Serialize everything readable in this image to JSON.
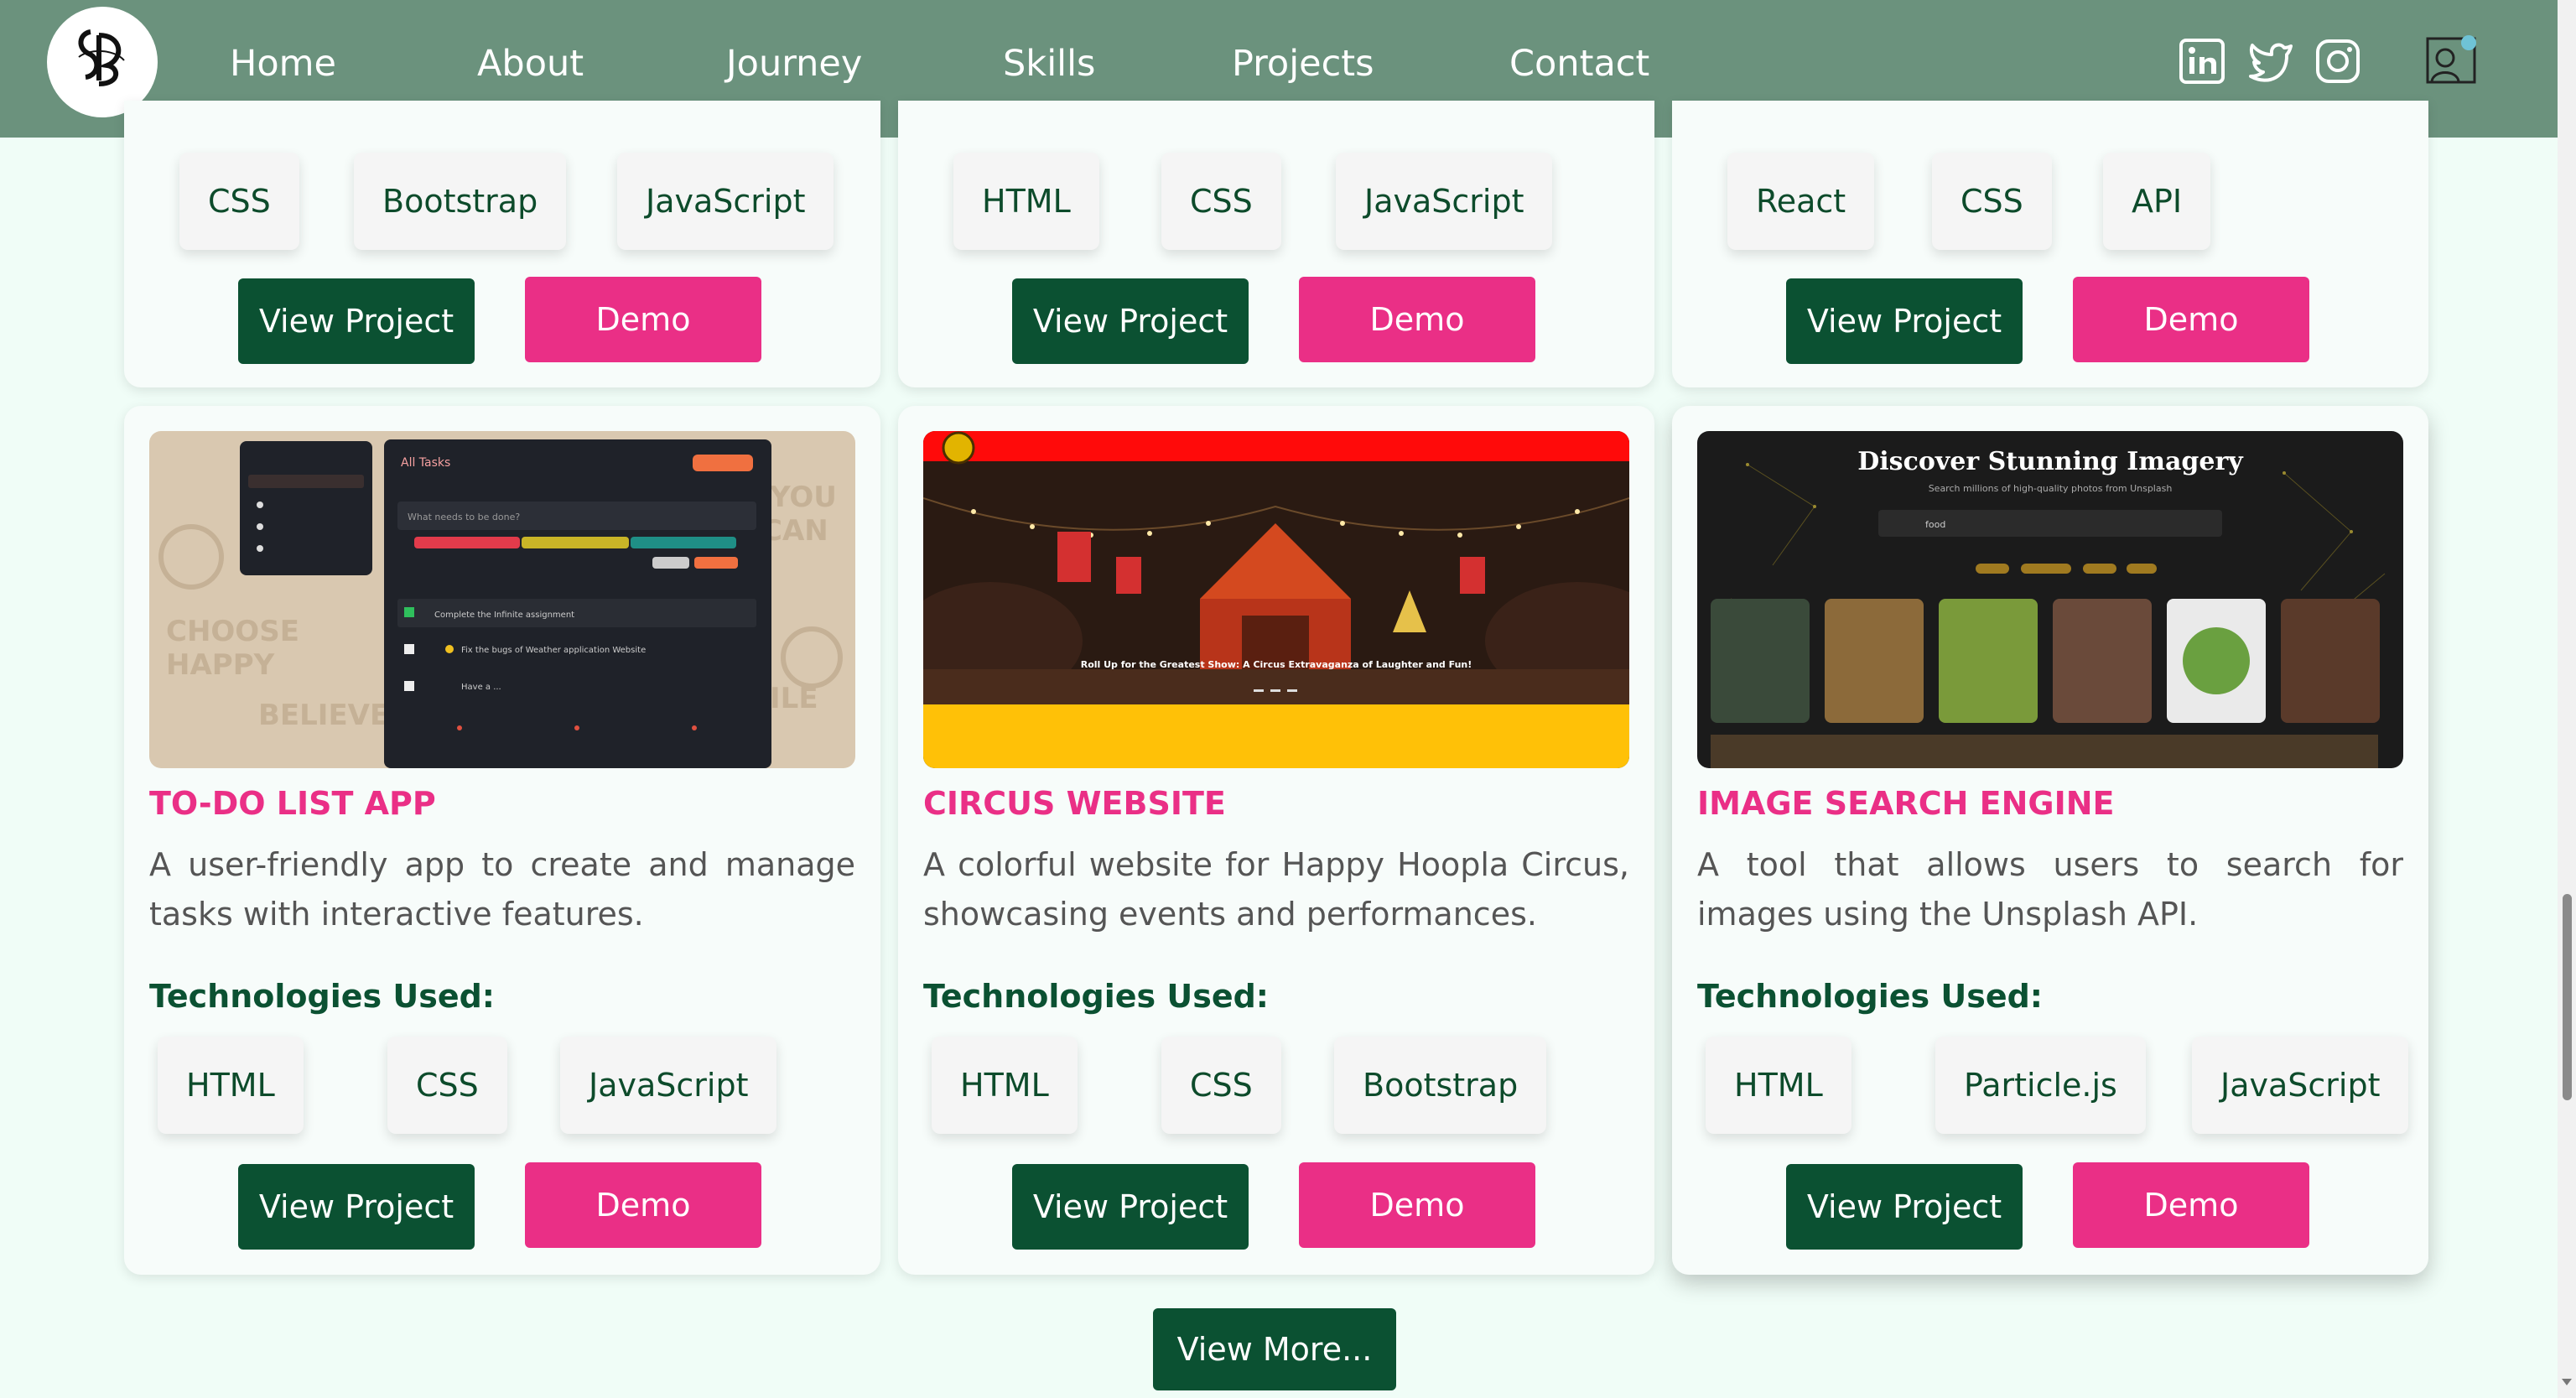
{
  "nav": {
    "links": [
      "Home",
      "About",
      "Journey",
      "Skills",
      "Projects",
      "Contact"
    ],
    "social": [
      "linkedin-icon",
      "twitter-icon",
      "instagram-icon"
    ],
    "brand_color": "#6b927d"
  },
  "top_cards": [
    {
      "tags": [
        "CSS",
        "Bootstrap",
        "JavaScript"
      ]
    },
    {
      "tags": [
        "HTML",
        "CSS",
        "JavaScript"
      ]
    },
    {
      "tags": [
        "React",
        "CSS",
        "API"
      ]
    }
  ],
  "projects": [
    {
      "title": "TO-DO LIST APP",
      "description": "A user-friendly app to create and manage tasks with interactive features.",
      "tags": [
        "HTML",
        "CSS",
        "JavaScript"
      ],
      "preview": {
        "header": "All Tasks",
        "input_placeholder": "What needs to be done?",
        "tasks": [
          "Complete the Infinite assignment",
          "Fix the bugs of Weather application Website",
          "Have a ..."
        ]
      }
    },
    {
      "title": "CIRCUS WEBSITE",
      "description": "A colorful website for Happy Hoopla Circus, showcasing events and performances.",
      "tags": [
        "HTML",
        "CSS",
        "Bootstrap"
      ],
      "preview": {
        "headline": "Roll Up for the Greatest Show: A Circus Extravaganza of Laughter and Fun!"
      }
    },
    {
      "title": "IMAGE SEARCH ENGINE",
      "description": "A tool that allows users to search for images using the Unsplash API.",
      "tags": [
        "HTML",
        "Particle.js",
        "JavaScript"
      ],
      "preview": {
        "heading": "Discover Stunning Imagery",
        "subheading": "Search millions of high-quality photos from Unsplash",
        "query": "food"
      }
    }
  ],
  "labels": {
    "technologies": "Technologies Used:",
    "view_project": "View Project",
    "demo": "Demo",
    "view_more": "View More..."
  },
  "colors": {
    "accent": "#ea2f86",
    "primary": "#0b5132",
    "background": "#f0fdf7"
  }
}
